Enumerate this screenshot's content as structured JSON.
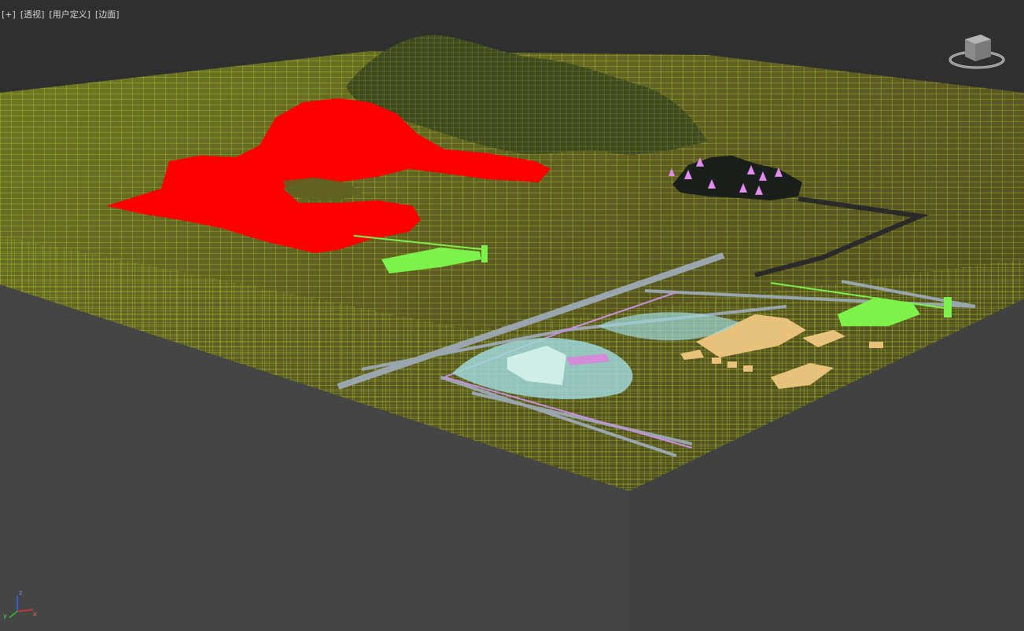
{
  "viewport": {
    "label": {
      "menu": "[+]",
      "view": "[透视]",
      "shading": "[用户定义]",
      "edges": "[边面]"
    },
    "viewcube": {
      "icon": "viewcube-icon"
    },
    "axis_tripod": {
      "x": "x",
      "y": "y",
      "z": "z"
    }
  },
  "colors": {
    "background": "#444444",
    "frame": "#c9a24a",
    "terrain_wire": "#c6e83a",
    "terrain_fill": "#5b5a22",
    "selection_red": "#ff0000",
    "building_green": "#7cf24a",
    "building_tan": "#e8c27a",
    "road": "#9aa6ad",
    "grid_line": "#1c1cb0"
  }
}
